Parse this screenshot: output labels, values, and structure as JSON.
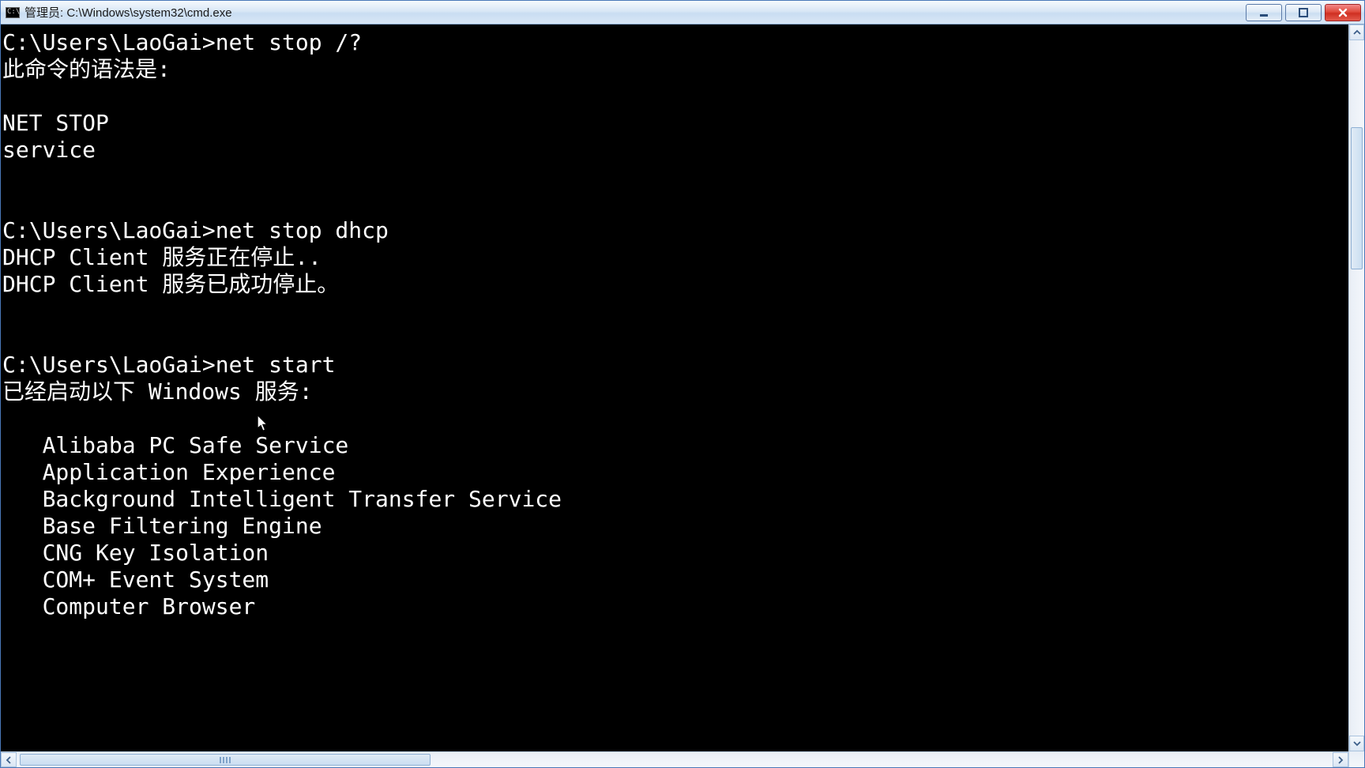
{
  "titlebar": {
    "title": "管理员: C:\\Windows\\system32\\cmd.exe"
  },
  "terminal": {
    "prompt": "C:\\Users\\LaoGai>",
    "blocks": [
      {
        "cmd": "net stop /?",
        "out": [
          "此命令的语法是:",
          "",
          "NET STOP",
          "service",
          "",
          ""
        ]
      },
      {
        "cmd": "net stop dhcp",
        "out": [
          "DHCP Client 服务正在停止..",
          "DHCP Client 服务已成功停止。",
          "",
          ""
        ]
      },
      {
        "cmd": "net start",
        "out_header": "已经启动以下 Windows 服务:",
        "services": [
          "Alibaba PC Safe Service",
          "Application Experience",
          "Background Intelligent Transfer Service",
          "Base Filtering Engine",
          "CNG Key Isolation",
          "COM+ Event System",
          "Computer Browser"
        ]
      }
    ]
  }
}
